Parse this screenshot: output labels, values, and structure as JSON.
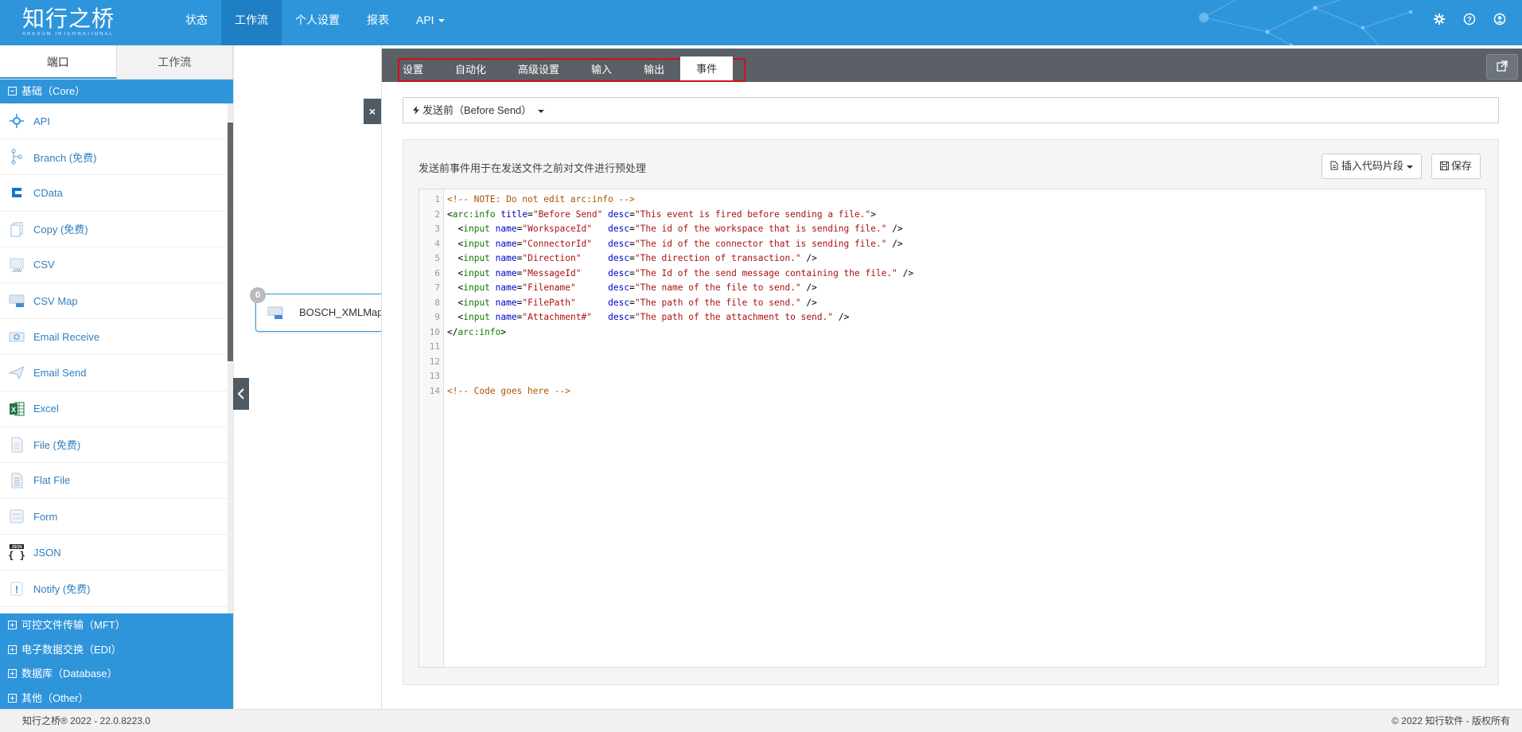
{
  "brand": {
    "logo_text": "知行之桥",
    "logo_sub": "ARESUM INTERNATIONAL"
  },
  "nav": {
    "items": [
      "状态",
      "工作流",
      "个人设置",
      "报表",
      "API"
    ]
  },
  "topicons": [
    "gear-icon",
    "help-icon",
    "user-icon"
  ],
  "sidebar": {
    "tabs": [
      "端口",
      "工作流"
    ],
    "core_group": "基础（Core）",
    "items": [
      {
        "label": "API",
        "icon": "api-icon"
      },
      {
        "label": "Branch (免费)",
        "icon": "branch-icon"
      },
      {
        "label": "CData",
        "icon": "cdata-icon"
      },
      {
        "label": "Copy (免费)",
        "icon": "copy-icon"
      },
      {
        "label": "CSV",
        "icon": "csv-icon"
      },
      {
        "label": "CSV Map",
        "icon": "csv-map-icon"
      },
      {
        "label": "Email Receive",
        "icon": "email-receive-icon"
      },
      {
        "label": "Email Send",
        "icon": "email-send-icon"
      },
      {
        "label": "Excel",
        "icon": "excel-icon"
      },
      {
        "label": "File (免费)",
        "icon": "file-icon"
      },
      {
        "label": "Flat File",
        "icon": "flat-file-icon"
      },
      {
        "label": "Form",
        "icon": "form-icon"
      },
      {
        "label": "JSON",
        "icon": "json-icon"
      },
      {
        "label": "Notify (免费)",
        "icon": "notify-icon"
      }
    ],
    "other_groups": [
      "可控文件传输（MFT）",
      "电子数据交换（EDI）",
      "数据库（Database）",
      "其他（Other）"
    ]
  },
  "canvas": {
    "node_label": "BOSCH_XMLMap_",
    "node_badge": "0"
  },
  "panel": {
    "tabs": [
      "设置",
      "自动化",
      "高级设置",
      "输入",
      "输出",
      "事件"
    ],
    "event_select": "发送前（Before Send）",
    "description": "发送前事件用于在发送文件之前对文件进行预处理",
    "snippet_button": "插入代码片段",
    "save_button": "保存",
    "code_lines": [
      "<!-- NOTE: Do not edit arc:info -->",
      "<arc:info title=\"Before Send\" desc=\"This event is fired before sending a file.\">",
      "  <input name=\"WorkspaceId\"   desc=\"The id of the workspace that is sending file.\" />",
      "  <input name=\"ConnectorId\"   desc=\"The id of the connector that is sending file.\" />",
      "  <input name=\"Direction\"     desc=\"The direction of transaction.\" />",
      "  <input name=\"MessageId\"     desc=\"The Id of the send message containing the file.\" />",
      "  <input name=\"Filename\"      desc=\"The name of the file to send.\" />",
      "  <input name=\"FilePath\"      desc=\"The path of the file to send.\" />",
      "  <input name=\"Attachment#\"   desc=\"The path of the attachment to send.\" />",
      "</arc:info>",
      "",
      "",
      "",
      "<!-- Code goes here -->"
    ]
  },
  "footer": {
    "left": "知行之桥® 2022 - 22.0.8223.0",
    "right": "© 2022 知行软件 - 版权所有"
  }
}
